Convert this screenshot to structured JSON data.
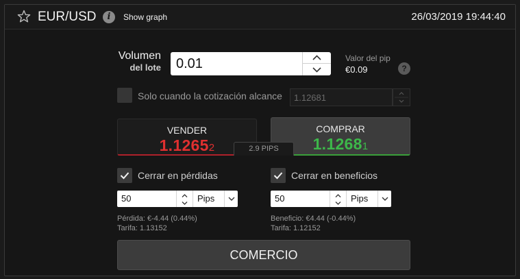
{
  "header": {
    "pair": "EUR/USD",
    "show_graph": "Show graph",
    "datetime": "26/03/2019 19:44:40",
    "icons": [
      "star-icon",
      "info-icon"
    ]
  },
  "volume": {
    "label_line1": "Volumen",
    "label_line2": "del lote",
    "value": "0.01",
    "pip_title": "Valor del pip",
    "pip_value": "€0.09",
    "help": "?"
  },
  "limit": {
    "label": "Solo cuando la cotización alcance",
    "value": "1.12681",
    "checked": false,
    "enabled": false
  },
  "sell": {
    "label": "VENDER",
    "price_main": "1.1265",
    "price_last": "2",
    "color": "#e03030"
  },
  "buy": {
    "label": "COMPRAR",
    "price_main": "1.1268",
    "price_last": "1",
    "color": "#3db84a"
  },
  "spread": "2.9 PIPS",
  "stop_loss": {
    "label": "Cerrar en pérdidas",
    "checked": true,
    "value": "50",
    "unit": "Pips",
    "info1": "Pérdida: €-4.44 (0.44%)",
    "info2": "Tarifa: 1.13152"
  },
  "take_profit": {
    "label": "Cerrar en beneficios",
    "checked": true,
    "value": "50",
    "unit": "Pips",
    "info1": "Beneficio: €4.44 (-0.44%)",
    "info2": "Tarifa: 1.12152"
  },
  "trade_button": "COMERCIO"
}
